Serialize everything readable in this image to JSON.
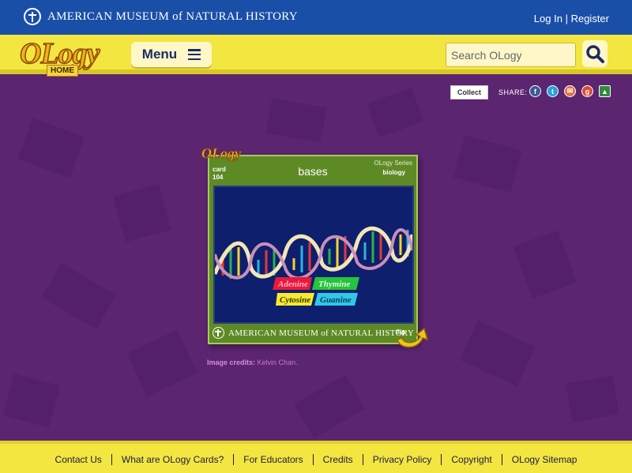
{
  "topbar": {
    "museum_name": "AMERICAN MUSEUM of NATURAL HISTORY",
    "login": "Log In",
    "separator": "|",
    "register": "Register"
  },
  "header": {
    "logo_word": "OLogy",
    "logo_sub": "HOME",
    "menu_label": "Menu",
    "search_placeholder": "Search OLogy"
  },
  "toolbar": {
    "collect_label": "Collect",
    "share_label": "SHARE:",
    "share_icons": [
      "facebook-icon",
      "twitter-icon",
      "email-icon",
      "google-plus-icon",
      "google-classroom-icon"
    ]
  },
  "card": {
    "badge": "OLogy",
    "card_label": "card",
    "card_number": "104",
    "title": "bases",
    "series": "OLogy Series",
    "topic": "biology",
    "base_labels": [
      "Adenine",
      "Thymine",
      "Cytosine",
      "Guanine"
    ],
    "footer_museum": "AMERICAN MUSEUM of NATURAL HISTORY",
    "flip_label": "flip"
  },
  "credits": {
    "label": "Image credits:",
    "value": "Kelvin Chan."
  },
  "footer": {
    "links": [
      "Contact Us",
      "What are OLogy Cards?",
      "For Educators",
      "Credits",
      "Privacy Policy",
      "Copyright",
      "OLogy Sitemap"
    ]
  },
  "colors": {
    "topbar": "#1a4fa8",
    "header_yellow": "#f4e640",
    "background_purple": "#5b2570",
    "card_green": "#5e8a26",
    "card_image_blue": "#0e1f6d"
  }
}
